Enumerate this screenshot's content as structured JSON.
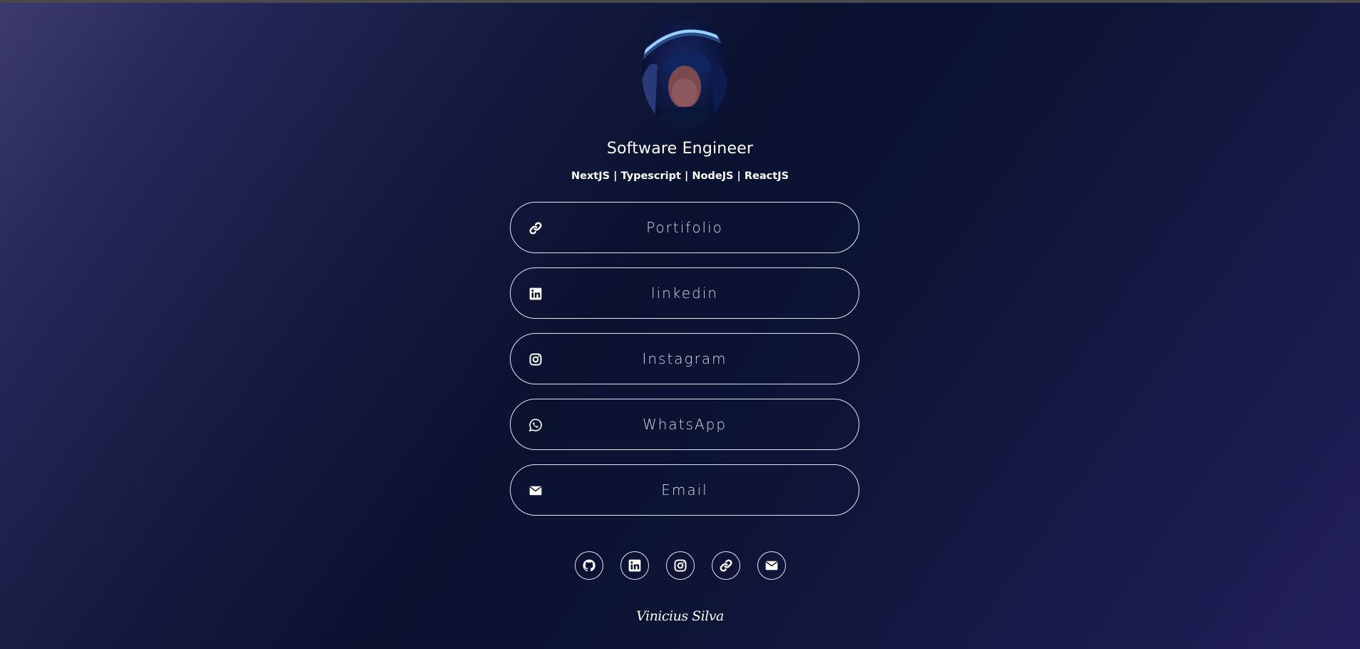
{
  "profile": {
    "title": "Software Engineer",
    "subtitle": "NextJS | Typescript | NodeJS | ReactJS",
    "avatar_icon": "profile-photo"
  },
  "links": [
    {
      "label": "Portifolio",
      "icon": "link-icon"
    },
    {
      "label": "linkedin",
      "icon": "linkedin-icon"
    },
    {
      "label": "Instagram",
      "icon": "instagram-icon"
    },
    {
      "label": "WhatsApp",
      "icon": "whatsapp-icon"
    },
    {
      "label": "Email",
      "icon": "envelope-icon"
    }
  ],
  "socials": [
    "github-icon",
    "linkedin-icon",
    "instagram-icon",
    "link-icon",
    "envelope-icon"
  ],
  "footer": {
    "name": "Vinicius Silva"
  },
  "colors": {
    "background_dark": "#0b1230",
    "background_light": "#3d3b6e",
    "border": "#e6e6ee",
    "text": "#ffffff"
  }
}
